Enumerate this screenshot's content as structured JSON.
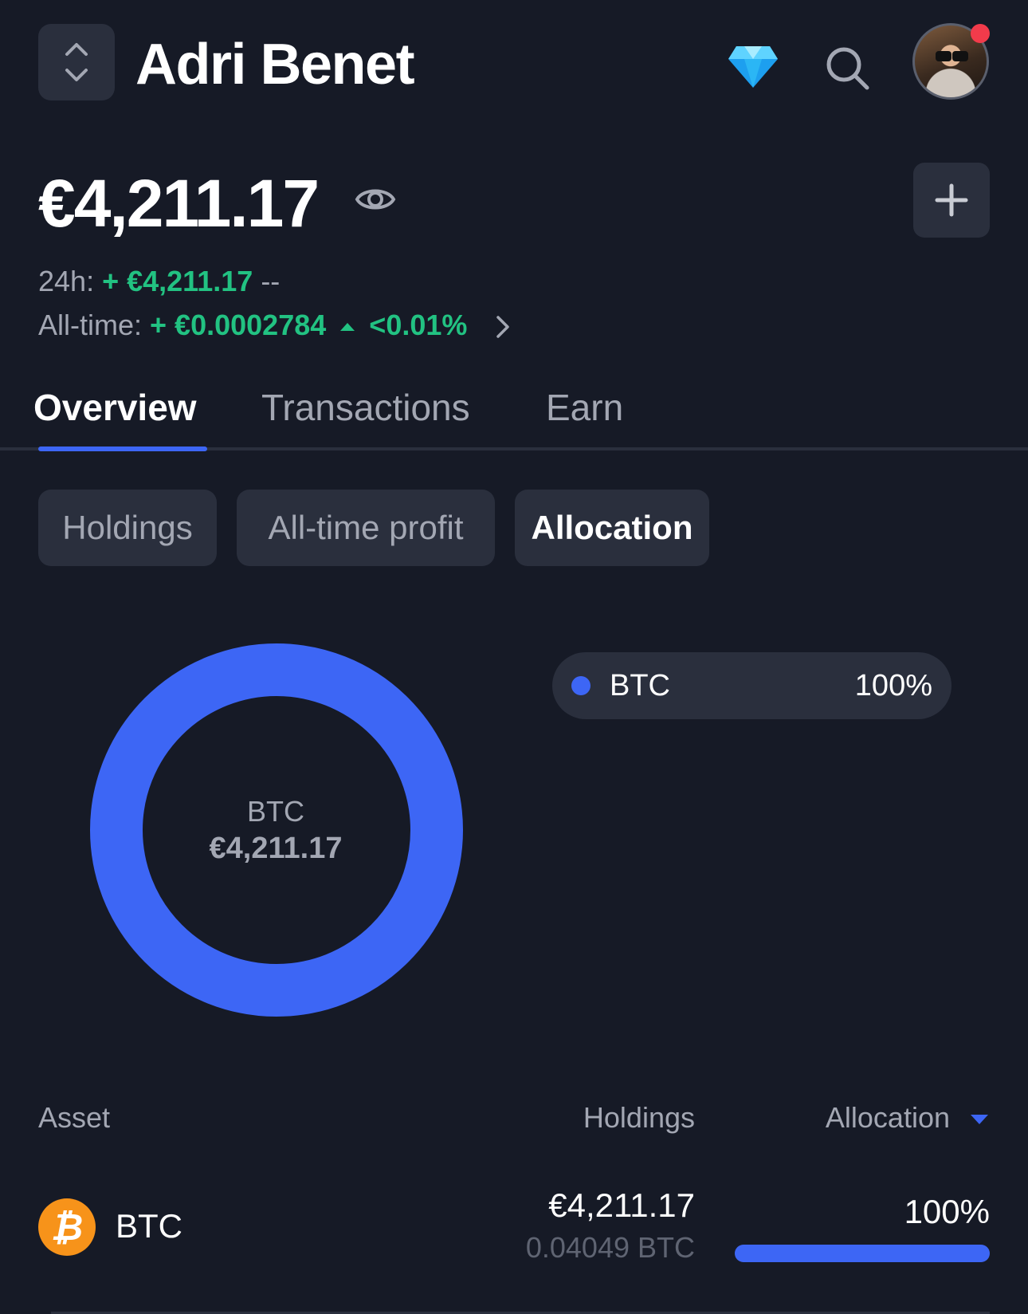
{
  "header": {
    "account_name": "Adri Benet",
    "icons": [
      "chevron-up-down-icon",
      "diamond-icon",
      "search-icon",
      "avatar",
      "plus-icon",
      "eye-icon",
      "chevron-right-icon",
      "triangle-up-icon",
      "bitcoin-icon",
      "caret-down-icon"
    ]
  },
  "balance": {
    "total": "€4,211.17",
    "h24_label": "24h:",
    "h24_change": "+ €4,211.17",
    "h24_pct": "--",
    "alltime_label": "All-time:",
    "alltime_change": "+ €0.0002784",
    "alltime_pct": "<0.01%"
  },
  "tabs": [
    {
      "label": "Overview",
      "active": true
    },
    {
      "label": "Transactions",
      "active": false
    },
    {
      "label": "Earn",
      "active": false
    }
  ],
  "chips": [
    {
      "label": "Holdings",
      "active": false
    },
    {
      "label": "All-time profit",
      "active": false
    },
    {
      "label": "Allocation",
      "active": true
    }
  ],
  "chart_data": {
    "type": "pie",
    "categories": [
      "BTC"
    ],
    "values": [
      100
    ],
    "center_label": "BTC",
    "center_value": "€4,211.17",
    "legend": [
      {
        "name": "BTC",
        "value": "100%"
      }
    ]
  },
  "table": {
    "headers": {
      "asset": "Asset",
      "holdings": "Holdings",
      "allocation": "Allocation"
    },
    "rows": [
      {
        "asset": "BTC",
        "holdings_value": "€4,211.17",
        "holdings_qty": "0.04049 BTC",
        "allocation": "100%",
        "allocation_fraction": 1.0
      }
    ]
  },
  "colors": {
    "background": "#161a26",
    "surface": "#2a2f3d",
    "accent": "#3d66f5",
    "positive": "#22c282",
    "btc": "#f7931a",
    "notification": "#f23b4b"
  }
}
